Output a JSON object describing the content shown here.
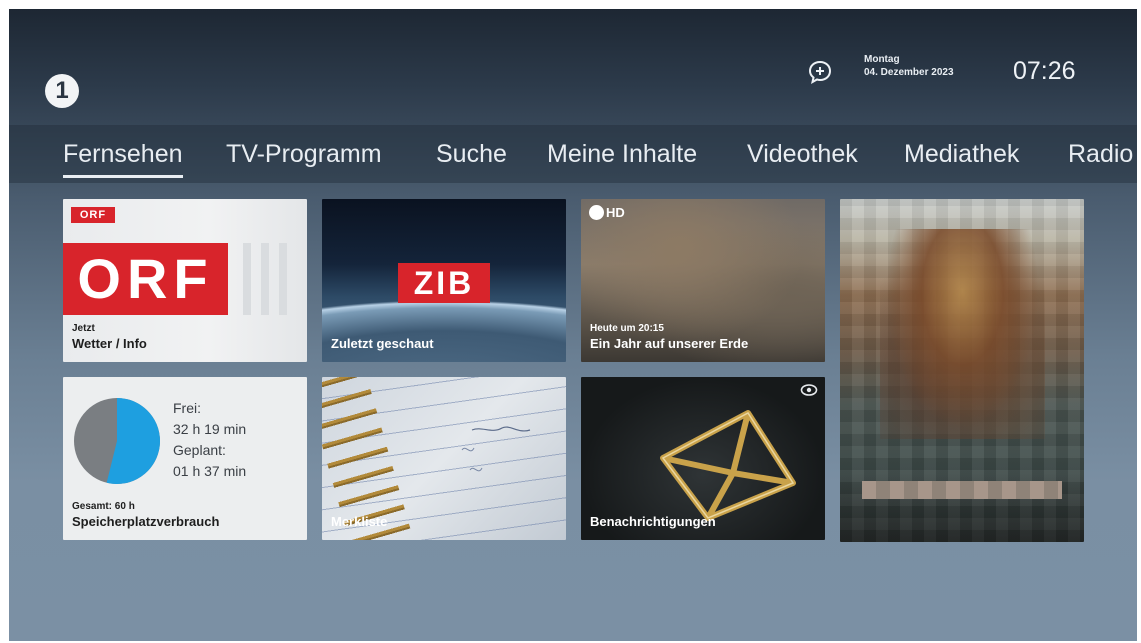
{
  "header": {
    "profile_badge": "1",
    "date_day": "Montag",
    "date_full": "04. Dezember 2023",
    "time": "07:26",
    "icons": {
      "messages": "speech-bubble-plus-icon"
    }
  },
  "nav": {
    "tabs": [
      {
        "label": "Fernsehen",
        "active": true
      },
      {
        "label": "TV-Programm",
        "active": false
      },
      {
        "label": "Suche",
        "active": false
      },
      {
        "label": "Meine Inhalte",
        "active": false
      },
      {
        "label": "Videothek",
        "active": false
      },
      {
        "label": "Mediathek",
        "active": false
      },
      {
        "label": "Radio",
        "active": false
      }
    ]
  },
  "tiles": {
    "live": {
      "logo_small": "ORF",
      "logo_big": "ORF",
      "subtitle": "Jetzt",
      "title": "Wetter / Info"
    },
    "recent": {
      "logo": "ZIB",
      "title": "Zuletzt geschaut"
    },
    "tonight": {
      "channel_logo": "HD",
      "subtitle": "Heute um 20:15",
      "title": "Ein Jahr auf unserer Erde"
    },
    "storage": {
      "free_label": "Frei:",
      "free_value": "32 h 19 min",
      "planned_label": "Geplant:",
      "planned_value": "01 h 37 min",
      "total": "Gesamt: 60 h",
      "title": "Speicherplatzverbrauch",
      "free_hours": 32.32,
      "planned_hours": 1.62,
      "total_hours": 60
    },
    "watchlist": {
      "title": "Merkliste"
    },
    "notifications": {
      "title": "Benachrichtigungen",
      "icons": {
        "badge": "eye-icon"
      }
    }
  },
  "colors": {
    "brand_red": "#d8242b",
    "pie_used": "#7a7e82",
    "pie_free": "#1e9fe0"
  }
}
